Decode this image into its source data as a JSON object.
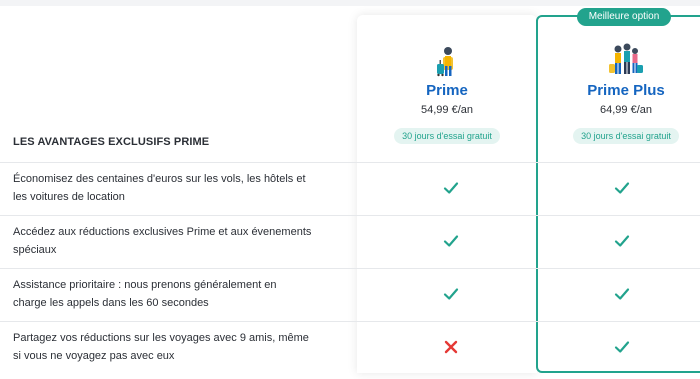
{
  "section_title": "LES AVANTAGES EXCLUSIFS PRIME",
  "badge": "Meilleure option",
  "plans": [
    {
      "name": "Prime",
      "price": "54,99 €/an",
      "trial": "30 jours d'essai gratuit",
      "icon": "traveler-with-suitcase-icon"
    },
    {
      "name": "Prime Plus",
      "price": "64,99 €/an",
      "trial": "30 jours d'essai gratuit",
      "icon": "group-of-travelers-icon"
    }
  ],
  "benefits": [
    {
      "text": "Économisez des centaines d'euros sur les vols, les hôtels et les voitures de location",
      "prime": true,
      "plus": true
    },
    {
      "text": "Accédez aux réductions exclusives Prime et aux évenements spéciaux",
      "prime": true,
      "plus": true
    },
    {
      "text": "Assistance prioritaire : nous prenons généralement en charge les appels dans les 60 secondes",
      "prime": true,
      "plus": true
    },
    {
      "text": "Partagez vos réductions sur les voyages avec 9 amis, même si vous ne voyagez pas avec eux",
      "prime": false,
      "plus": true
    }
  ],
  "colors": {
    "accent": "#22a38d",
    "plan_name": "#1565c0",
    "cross": "#e53935"
  }
}
